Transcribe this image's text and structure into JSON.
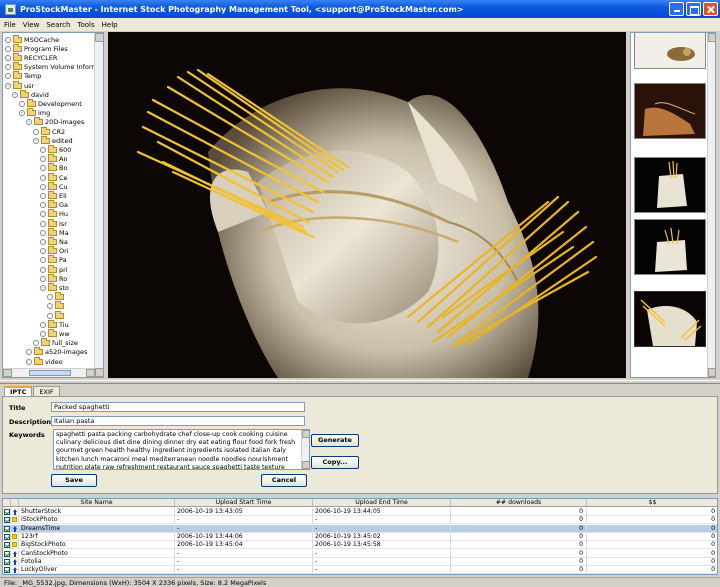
{
  "window": {
    "title": "ProStockMaster - Internet Stock Photography Management Tool, <support@ProStockMaster.com>"
  },
  "menu": [
    "File",
    "View",
    "Search",
    "Tools",
    "Help"
  ],
  "tree": [
    {
      "label": "MSOCache",
      "level": 1
    },
    {
      "label": "Program Files",
      "level": 1
    },
    {
      "label": "RECYCLER",
      "level": 1
    },
    {
      "label": "System Volume Information",
      "level": 1
    },
    {
      "label": "Temp",
      "level": 1
    },
    {
      "label": "usr",
      "level": 1,
      "open": true
    },
    {
      "label": "david",
      "level": 2,
      "open": true
    },
    {
      "label": "Development",
      "level": 3
    },
    {
      "label": "img",
      "level": 3,
      "open": true
    },
    {
      "label": "20D-images",
      "level": 4,
      "open": true
    },
    {
      "label": "CR2",
      "level": 5
    },
    {
      "label": "edited",
      "level": 5,
      "open": true
    },
    {
      "label": "600",
      "level": 6
    },
    {
      "label": "An",
      "level": 6
    },
    {
      "label": "Bo",
      "level": 6
    },
    {
      "label": "Ce",
      "level": 6
    },
    {
      "label": "Cu",
      "level": 6
    },
    {
      "label": "Eli",
      "level": 6
    },
    {
      "label": "Ga",
      "level": 6
    },
    {
      "label": "Hu",
      "level": 6
    },
    {
      "label": "Isr",
      "level": 6
    },
    {
      "label": "Ma",
      "level": 6
    },
    {
      "label": "Na",
      "level": 6
    },
    {
      "label": "Ori",
      "level": 6
    },
    {
      "label": "Pa",
      "level": 6
    },
    {
      "label": "pri",
      "level": 6
    },
    {
      "label": "Ro",
      "level": 6
    },
    {
      "label": "sto",
      "level": 6,
      "open": true
    },
    {
      "label": "",
      "level": 7
    },
    {
      "label": "",
      "level": 7
    },
    {
      "label": "",
      "level": 7
    },
    {
      "label": "Tiu",
      "level": 6
    },
    {
      "label": "ww",
      "level": 6
    },
    {
      "label": "full_size",
      "level": 5
    },
    {
      "label": "a520-images",
      "level": 4
    },
    {
      "label": "video",
      "level": 4
    }
  ],
  "tabs": [
    "IPTC",
    "EXIF"
  ],
  "iptc": {
    "title_label": "Title",
    "title_value": "Packed spaghetti",
    "description_label": "Description",
    "description_value": "Italian pasta",
    "keywords_label": "Keywords",
    "keywords_value": "spaghetti pasta packing carbohydrate chef close-up cook cooking cuisine culinary delicious diet dine dining dinner dry eat eating flour food fork fresh gourmet green health healthy ingredient ingredients isolated italian italy kitchen lunch macaroni meal mediterranean noodle noodles nourishment nutrition plate raw refreshment restaurant sauce spaghetti taste texture tomato tomatoes uncooked vegetable wheat",
    "generate_button": "Generate",
    "copy_button": "Copy...",
    "save_button": "Save",
    "cancel_button": "Cancel"
  },
  "table": {
    "headers": [
      "Site Name",
      "Upload Start Time",
      "Upload End Time",
      "## downloads",
      "$$"
    ],
    "rows": [
      {
        "site": "ShutterStock",
        "icon": "up-arrow-icon",
        "start": "2006-10-19  13:43:05",
        "end": "2006-10-19  13:44:05",
        "downloads": "0",
        "earnings": "0",
        "selected": false
      },
      {
        "site": "iStockPhoto",
        "icon": "yellow-square-icon",
        "start": "-",
        "end": "-",
        "downloads": "0",
        "earnings": "0",
        "selected": false
      },
      {
        "site": "DreamsTime",
        "icon": "up-arrow-icon",
        "start": "-",
        "end": "-",
        "downloads": "0",
        "earnings": "0",
        "selected": true
      },
      {
        "site": "123rf",
        "icon": "yellow-square-icon",
        "start": "2006-10-19  13:44:06",
        "end": "2006-10-19  13:45:02",
        "downloads": "0",
        "earnings": "0",
        "selected": false
      },
      {
        "site": "BigStockPhoto",
        "icon": "yellow-square-icon",
        "start": "2006-10-19  13:45:04",
        "end": "2006-10-19  13:45:58",
        "downloads": "0",
        "earnings": "0",
        "selected": false
      },
      {
        "site": "CanStockPhoto",
        "icon": "up-arrow-icon",
        "start": "-",
        "end": "-",
        "downloads": "0",
        "earnings": "0",
        "selected": false
      },
      {
        "site": "Fotolia",
        "icon": "up-arrow-icon",
        "start": "-",
        "end": "-",
        "downloads": "0",
        "earnings": "0",
        "selected": false
      },
      {
        "site": "LuckyOliver",
        "icon": "up-arrow-icon",
        "start": "-",
        "end": "-",
        "downloads": "0",
        "earnings": "0",
        "selected": false
      }
    ]
  },
  "status": "File: _MG_5532.jpg, Dimensions (WxH): 3504 X 2336 pixels, Size: 8.2 MegaPixels",
  "colors": {
    "title_bar": "#0a5ae0",
    "selection": "#b7cce6",
    "pasta": "#f1c233"
  }
}
